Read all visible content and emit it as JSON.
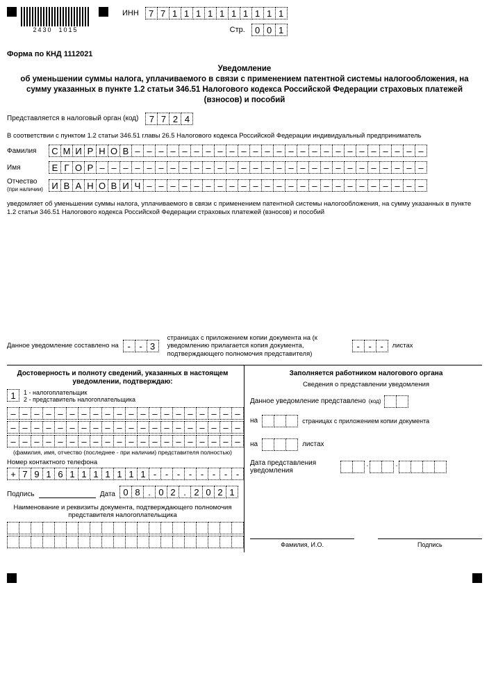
{
  "barcode": {
    "num1": "2430",
    "num2": "1015"
  },
  "header": {
    "inn_label": "ИНН",
    "inn": "771111111111",
    "page_label": "Стр.",
    "page": "001"
  },
  "form_code": "Форма по КНД 1112021",
  "title1": "Уведомление",
  "title2": "об уменьшении суммы налога, уплачиваемого в связи с применением патентной системы налогообложения, на сумму указанных в пункте 1.2 статьи 346.51 Налогового кодекса Российской Федерации страховых платежей (взносов) и пособий",
  "org": {
    "label": "Представляется в налоговый орган (код)",
    "code": "7724"
  },
  "legal_text": "В соответствии с пунктом 1.2 статьи 346.51 главы 26.5 Налогового кодекса Российской Федерации индивидуальный предприниматель",
  "name": {
    "surname_label": "Фамилия",
    "surname": "СМИРНОВ",
    "firstname_label": "Имя",
    "firstname": "ЕГОР",
    "patronymic_label": "Отчество",
    "patronymic_sub": "(при наличии)",
    "patronymic": "ИВАНОВИЧ"
  },
  "notify_text": "уведомляет об уменьшении суммы налога, уплачиваемого в связи с применением патентной системы налогообложения, на сумму указанных в пункте 1.2 статьи 346.51 Налогового кодекса Российской Федерации страховых платежей (взносов) и пособий",
  "pages": {
    "prefix": "Данное уведомление составлено на",
    "pages_val": "--3",
    "mid_text": "страницах с приложением копии документа на (к уведомлению прилагается копия документа, подтверждающего полномочия представителя)",
    "sheets_val": "---",
    "sheets_label": "листах"
  },
  "left": {
    "title": "Достоверность и полноту сведений, указанных в настоящем уведомлении, подтверждаю:",
    "submitter": "1",
    "opt1": "1 - налогоплательщик",
    "opt2": "2 - представитель налогоплательщика",
    "rep_hint": "(фамилия, имя, отчество (последнее - при наличии) представителя полностью)",
    "phone_label": "Номер контактного телефона",
    "phone": "+79161111111--------",
    "sign_label": "Подпись",
    "date_label": "Дата",
    "date": "08.02.2021",
    "doc_title": "Наименование и реквизиты документа, подтверждающего полномочия представителя налогоплательщика"
  },
  "right": {
    "title": "Заполняется работником налогового органа",
    "sub": "Сведения о представлении уведомления",
    "presented": "Данное уведомление представлено",
    "code_hint": "(код)",
    "on": "на",
    "pages_text": "страницах с приложением копии документа",
    "sheets": "листах",
    "date_label": "Дата представления уведомления",
    "fio": "Фамилия, И.О.",
    "sign": "Подпись"
  }
}
